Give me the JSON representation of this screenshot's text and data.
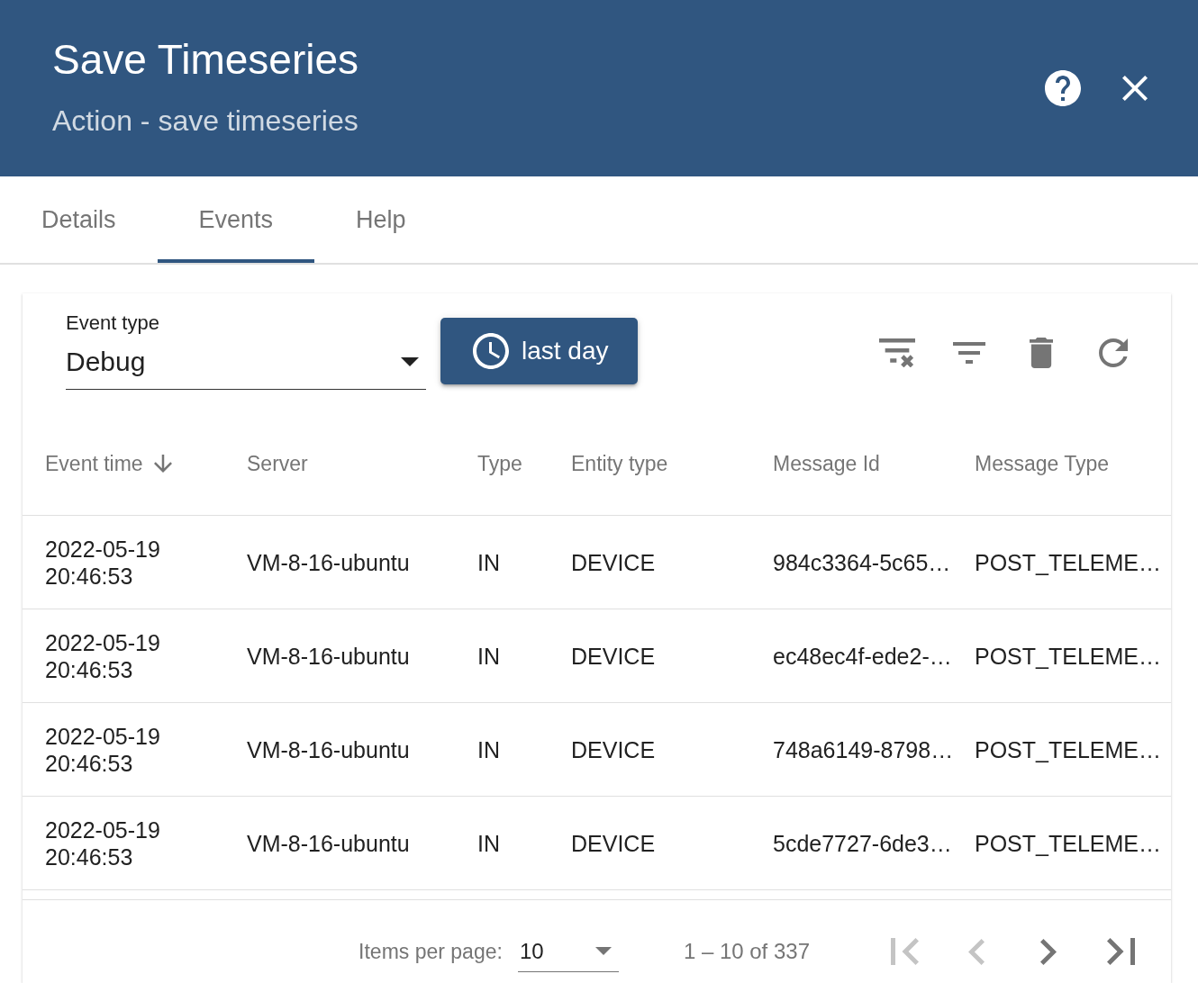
{
  "dialog": {
    "title": "Save Timeseries",
    "subtitle": "Action - save timeseries"
  },
  "tabs": [
    {
      "label": "Details",
      "selected": false
    },
    {
      "label": "Events",
      "selected": true
    },
    {
      "label": "Help",
      "selected": false
    }
  ],
  "toolbar": {
    "event_type": {
      "label": "Event type",
      "value": "Debug"
    },
    "time_button": {
      "label": "last day"
    }
  },
  "table": {
    "columns": [
      {
        "label": "Event time",
        "sort_descending": true
      },
      {
        "label": "Server",
        "sort_descending": false
      },
      {
        "label": "Type",
        "sort_descending": false
      },
      {
        "label": "Entity type",
        "sort_descending": false
      },
      {
        "label": "Message Id",
        "sort_descending": false
      },
      {
        "label": "Message Type",
        "sort_descending": false
      }
    ],
    "rows": [
      {
        "cells": [
          "2022-05-19 20:46:53",
          "VM-8-16-ubuntu",
          "IN",
          "DEVICE",
          "984c3364-5c65…",
          "POST_TELEME…"
        ]
      },
      {
        "cells": [
          "2022-05-19 20:46:53",
          "VM-8-16-ubuntu",
          "IN",
          "DEVICE",
          "ec48ec4f-ede2-…",
          "POST_TELEME…"
        ]
      },
      {
        "cells": [
          "2022-05-19 20:46:53",
          "VM-8-16-ubuntu",
          "IN",
          "DEVICE",
          "748a6149-8798…",
          "POST_TELEME…"
        ]
      },
      {
        "cells": [
          "2022-05-19 20:46:53",
          "VM-8-16-ubuntu",
          "IN",
          "DEVICE",
          "5cde7727-6de3…",
          "POST_TELEME…"
        ]
      }
    ]
  },
  "paginator": {
    "items_per_page": {
      "label": "Items per page:",
      "value": "10"
    },
    "range": "1 – 10 of 337",
    "nav": [
      {
        "kind": "first",
        "disabled": true
      },
      {
        "kind": "previous",
        "disabled": true
      },
      {
        "kind": "next",
        "disabled": false
      },
      {
        "kind": "last",
        "disabled": false
      }
    ]
  }
}
